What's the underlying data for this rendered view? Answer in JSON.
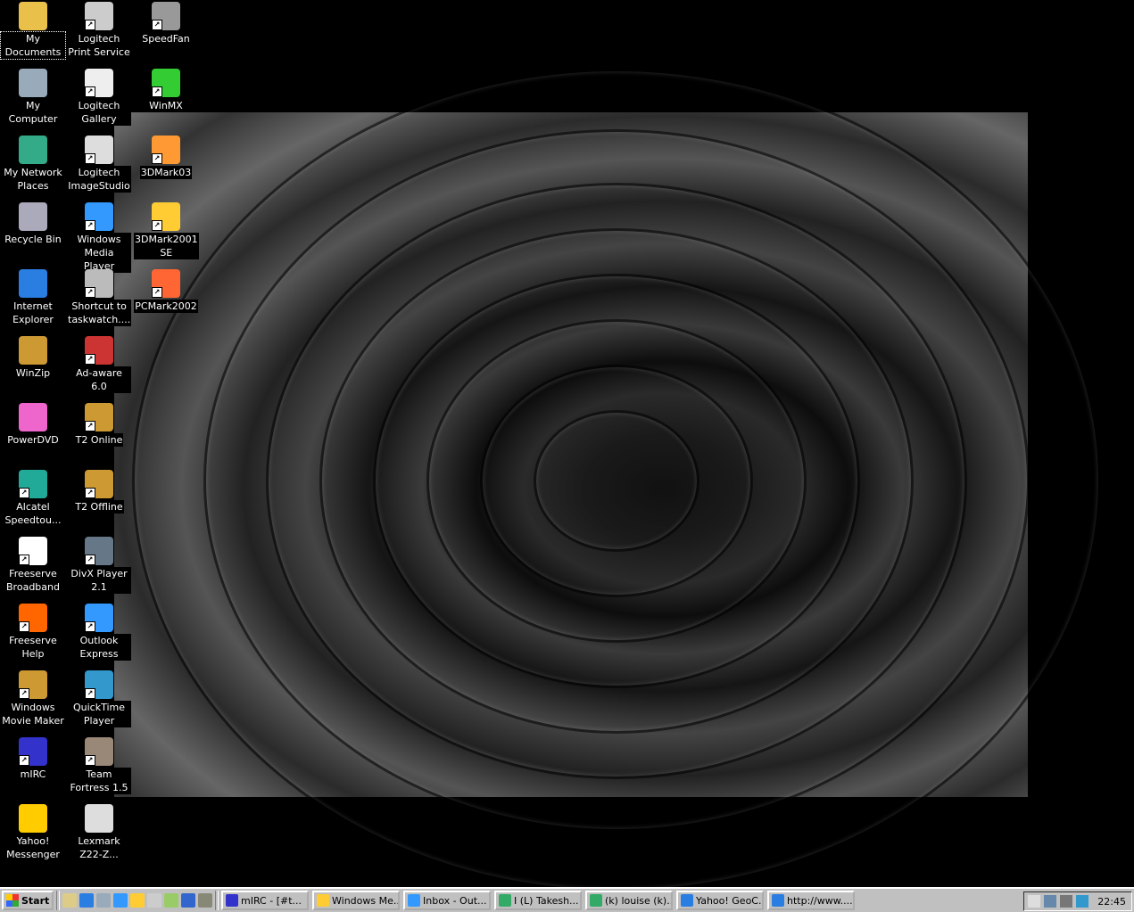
{
  "desktop": {
    "icons": [
      {
        "label": "My Documents",
        "icon": "folder-icon",
        "color": "#e8c04a",
        "col": 0,
        "row": 0,
        "shortcut": false,
        "selected": true
      },
      {
        "label": "My Computer",
        "icon": "computer-icon",
        "color": "#9ab",
        "col": 0,
        "row": 1,
        "shortcut": false
      },
      {
        "label": "My Network Places",
        "icon": "network-icon",
        "color": "#3a8",
        "col": 0,
        "row": 2,
        "shortcut": false
      },
      {
        "label": "Recycle Bin",
        "icon": "recycle-bin-icon",
        "color": "#aab",
        "col": 0,
        "row": 3,
        "shortcut": false
      },
      {
        "label": "Internet Explorer",
        "icon": "ie-icon",
        "color": "#2a7de1",
        "col": 0,
        "row": 4,
        "shortcut": false
      },
      {
        "label": "WinZip",
        "icon": "winzip-icon",
        "color": "#c93",
        "col": 0,
        "row": 5,
        "shortcut": false
      },
      {
        "label": "PowerDVD",
        "icon": "dvd-icon",
        "color": "#e6c",
        "col": 0,
        "row": 6,
        "shortcut": false
      },
      {
        "label": "Alcatel Speedtou...",
        "icon": "modem-icon",
        "color": "#2a9",
        "col": 0,
        "row": 7,
        "shortcut": true
      },
      {
        "label": "Freeserve Broadband",
        "icon": "freeserve-icon",
        "color": "#fff",
        "col": 0,
        "row": 8,
        "shortcut": true
      },
      {
        "label": "Freeserve Help",
        "icon": "help-icon",
        "color": "#f60",
        "col": 0,
        "row": 9,
        "shortcut": true
      },
      {
        "label": "Windows Movie Maker",
        "icon": "movie-maker-icon",
        "color": "#c93",
        "col": 0,
        "row": 10,
        "shortcut": true
      },
      {
        "label": "mIRC",
        "icon": "mirc-icon",
        "color": "#33c",
        "col": 0,
        "row": 11,
        "shortcut": true
      },
      {
        "label": "Yahoo! Messenger",
        "icon": "yahoo-icon",
        "color": "#fc0",
        "col": 0,
        "row": 12,
        "shortcut": false
      },
      {
        "label": "Logitech Print Service",
        "icon": "camera-icon",
        "color": "#ccc",
        "col": 1,
        "row": 0,
        "shortcut": true
      },
      {
        "label": "Logitech Gallery",
        "icon": "gallery-icon",
        "color": "#eee",
        "col": 1,
        "row": 1,
        "shortcut": true
      },
      {
        "label": "Logitech ImageStudio",
        "icon": "webcam-icon",
        "color": "#ddd",
        "col": 1,
        "row": 2,
        "shortcut": true
      },
      {
        "label": "Windows Media Player",
        "icon": "media-player-icon",
        "color": "#39f",
        "col": 1,
        "row": 3,
        "shortcut": true
      },
      {
        "label": "Shortcut to taskwatch....",
        "icon": "taskwatch-icon",
        "color": "#bbb",
        "col": 1,
        "row": 4,
        "shortcut": true
      },
      {
        "label": "Ad-aware 6.0",
        "icon": "adaware-icon",
        "color": "#c33",
        "col": 1,
        "row": 5,
        "shortcut": true
      },
      {
        "label": "T2 Online",
        "icon": "t2-icon",
        "color": "#c93",
        "col": 1,
        "row": 6,
        "shortcut": true
      },
      {
        "label": "T2 Offline",
        "icon": "t2-icon",
        "color": "#c93",
        "col": 1,
        "row": 7,
        "shortcut": true
      },
      {
        "label": "DivX Player 2.1",
        "icon": "divx-icon",
        "color": "#678",
        "col": 1,
        "row": 8,
        "shortcut": true
      },
      {
        "label": "Outlook Express",
        "icon": "outlook-icon",
        "color": "#39f",
        "col": 1,
        "row": 9,
        "shortcut": true
      },
      {
        "label": "QuickTime Player",
        "icon": "quicktime-icon",
        "color": "#39c",
        "col": 1,
        "row": 10,
        "shortcut": true
      },
      {
        "label": "Team Fortress 1.5",
        "icon": "tf-icon",
        "color": "#987",
        "col": 1,
        "row": 11,
        "shortcut": true
      },
      {
        "label": "Lexmark Z22-Z...",
        "icon": "printer-icon",
        "color": "#ddd",
        "col": 1,
        "row": 12,
        "shortcut": false
      },
      {
        "label": "SpeedFan",
        "icon": "fan-icon",
        "color": "#999",
        "col": 2,
        "row": 0,
        "shortcut": true
      },
      {
        "label": "WinMX",
        "icon": "winmx-icon",
        "color": "#3c3",
        "col": 2,
        "row": 1,
        "shortcut": true
      },
      {
        "label": "3DMark03",
        "icon": "3dmark-icon",
        "color": "#f93",
        "col": 2,
        "row": 2,
        "shortcut": true
      },
      {
        "label": "3DMark2001 SE",
        "icon": "3dmark2001-icon",
        "color": "#fc3",
        "col": 2,
        "row": 3,
        "shortcut": true
      },
      {
        "label": "PCMark2002",
        "icon": "pcmark-icon",
        "color": "#f63",
        "col": 2,
        "row": 4,
        "shortcut": true
      }
    ]
  },
  "taskbar": {
    "start_label": "Start",
    "quick_launch": [
      {
        "icon": "show-desktop-icon",
        "color": "#dc8"
      },
      {
        "icon": "ie-icon",
        "color": "#2a7de1"
      },
      {
        "icon": "my-computer-icon",
        "color": "#9ab"
      },
      {
        "icon": "outlook-icon",
        "color": "#39f"
      },
      {
        "icon": "media-player-icon",
        "color": "#fc3"
      },
      {
        "icon": "help-icon",
        "color": "#ccc"
      },
      {
        "icon": "pen-icon",
        "color": "#9c6"
      },
      {
        "icon": "compass-icon",
        "color": "#36c"
      },
      {
        "icon": "settings-icon",
        "color": "#887"
      }
    ],
    "tasks": [
      {
        "label": "mIRC - [#t...",
        "icon": "mirc-icon",
        "color": "#33c"
      },
      {
        "label": "Windows Me...",
        "icon": "media-player-icon",
        "color": "#fc3"
      },
      {
        "label": "Inbox - Out...",
        "icon": "outlook-icon",
        "color": "#39f"
      },
      {
        "label": "I (L) Takesh...",
        "icon": "msn-icon",
        "color": "#3a6"
      },
      {
        "label": "(k) louise (k)...",
        "icon": "msn-icon",
        "color": "#3a6"
      },
      {
        "label": "Yahoo! GeoC...",
        "icon": "ie-icon",
        "color": "#2a7de1"
      },
      {
        "label": "http://www....",
        "icon": "ie-icon",
        "color": "#2a7de1"
      }
    ],
    "tray": {
      "icons": [
        {
          "icon": "volume-icon",
          "color": "#ddd"
        },
        {
          "icon": "network-tray-icon",
          "color": "#68a"
        },
        {
          "icon": "taskwatch-tray-icon",
          "color": "#777"
        },
        {
          "icon": "connection-tray-icon",
          "color": "#39c"
        }
      ],
      "clock": "22:45"
    }
  }
}
